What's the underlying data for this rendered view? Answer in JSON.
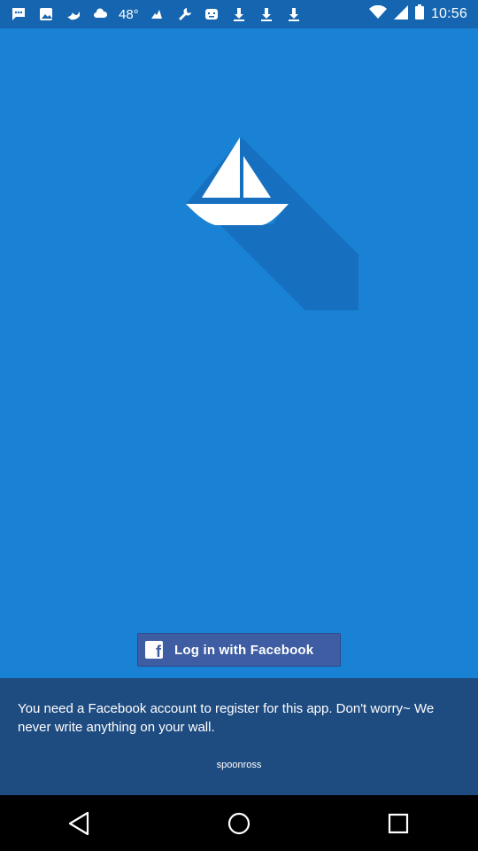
{
  "status_bar": {
    "icons": [
      "chat-bubble-icon",
      "image-icon",
      "bird-icon",
      "cloud-temperature-icon",
      "bird-icon",
      "wrench-icon",
      "face-icon",
      "download-icon",
      "download-icon",
      "download-icon"
    ],
    "temperature": "48°",
    "time": "10:56",
    "right_icons": [
      "wifi-icon",
      "signal-icon",
      "battery-icon"
    ]
  },
  "logo": {
    "icon": "sailboat-icon",
    "colors": {
      "sail": "#ffffff",
      "shadow": "#1668b8"
    }
  },
  "login": {
    "icon": "facebook-icon",
    "label": "Log in with Facebook",
    "color": "#3f5da3"
  },
  "info": {
    "message": "You need a Facebook account to register for this app. Don't worry~ We never write anything on your wall.",
    "credit": "spoonross",
    "panel_color": "#1f4c80"
  },
  "colors": {
    "background": "#1a82d4",
    "status_bar": "#1565b0"
  },
  "nav": {
    "back": "back-icon",
    "home": "home-icon",
    "recents": "recents-icon"
  }
}
